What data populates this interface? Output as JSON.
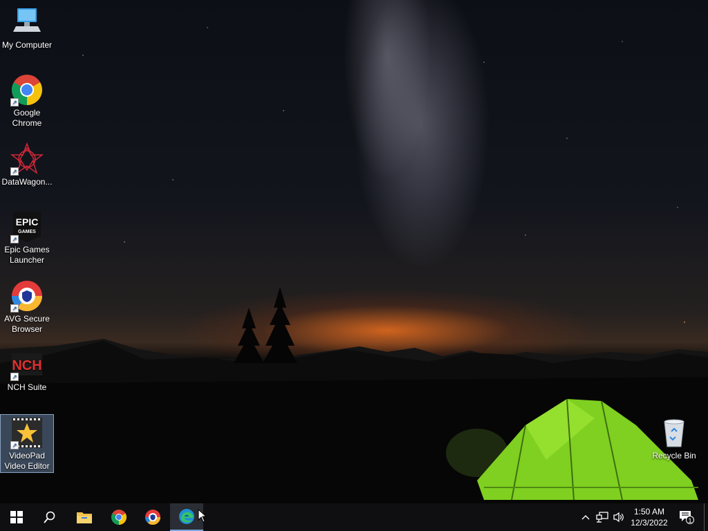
{
  "desktop": {
    "icons": [
      {
        "label": "My Computer",
        "icon": "computer-icon"
      },
      {
        "label": "Google Chrome",
        "icon": "chrome-icon"
      },
      {
        "label": "DataWagon...",
        "icon": "datawagon-icon"
      },
      {
        "label": "Epic Games Launcher",
        "icon": "epic-games-icon",
        "logo_text": "EPIC",
        "logo_sub": "GAMES"
      },
      {
        "label": "AVG Secure Browser",
        "icon": "avg-browser-icon"
      },
      {
        "label": "NCH Suite",
        "icon": "nch-icon",
        "logo_text": "NCH"
      },
      {
        "label": "VideoPad Video Editor",
        "icon": "videopad-icon",
        "selected": true
      },
      {
        "label": "Recycle Bin",
        "icon": "recycle-bin-icon"
      }
    ]
  },
  "taskbar": {
    "items": [
      {
        "name": "start",
        "icon": "windows-start-icon"
      },
      {
        "name": "search",
        "icon": "search-icon"
      },
      {
        "name": "file-explorer",
        "icon": "folder-icon"
      },
      {
        "name": "chrome",
        "icon": "chrome-icon"
      },
      {
        "name": "avg-browser",
        "icon": "avg-browser-icon"
      },
      {
        "name": "edge",
        "icon": "edge-icon",
        "active": true
      }
    ],
    "tray": {
      "icons": [
        "chevron-up-icon",
        "network-icon",
        "volume-icon"
      ],
      "time": "1:50 AM",
      "date": "12/3/2022",
      "notification_count": "1"
    }
  },
  "colors": {
    "taskbar": "#0f0f12",
    "tent": "#7fd020",
    "accent": "#7aa7e0"
  }
}
